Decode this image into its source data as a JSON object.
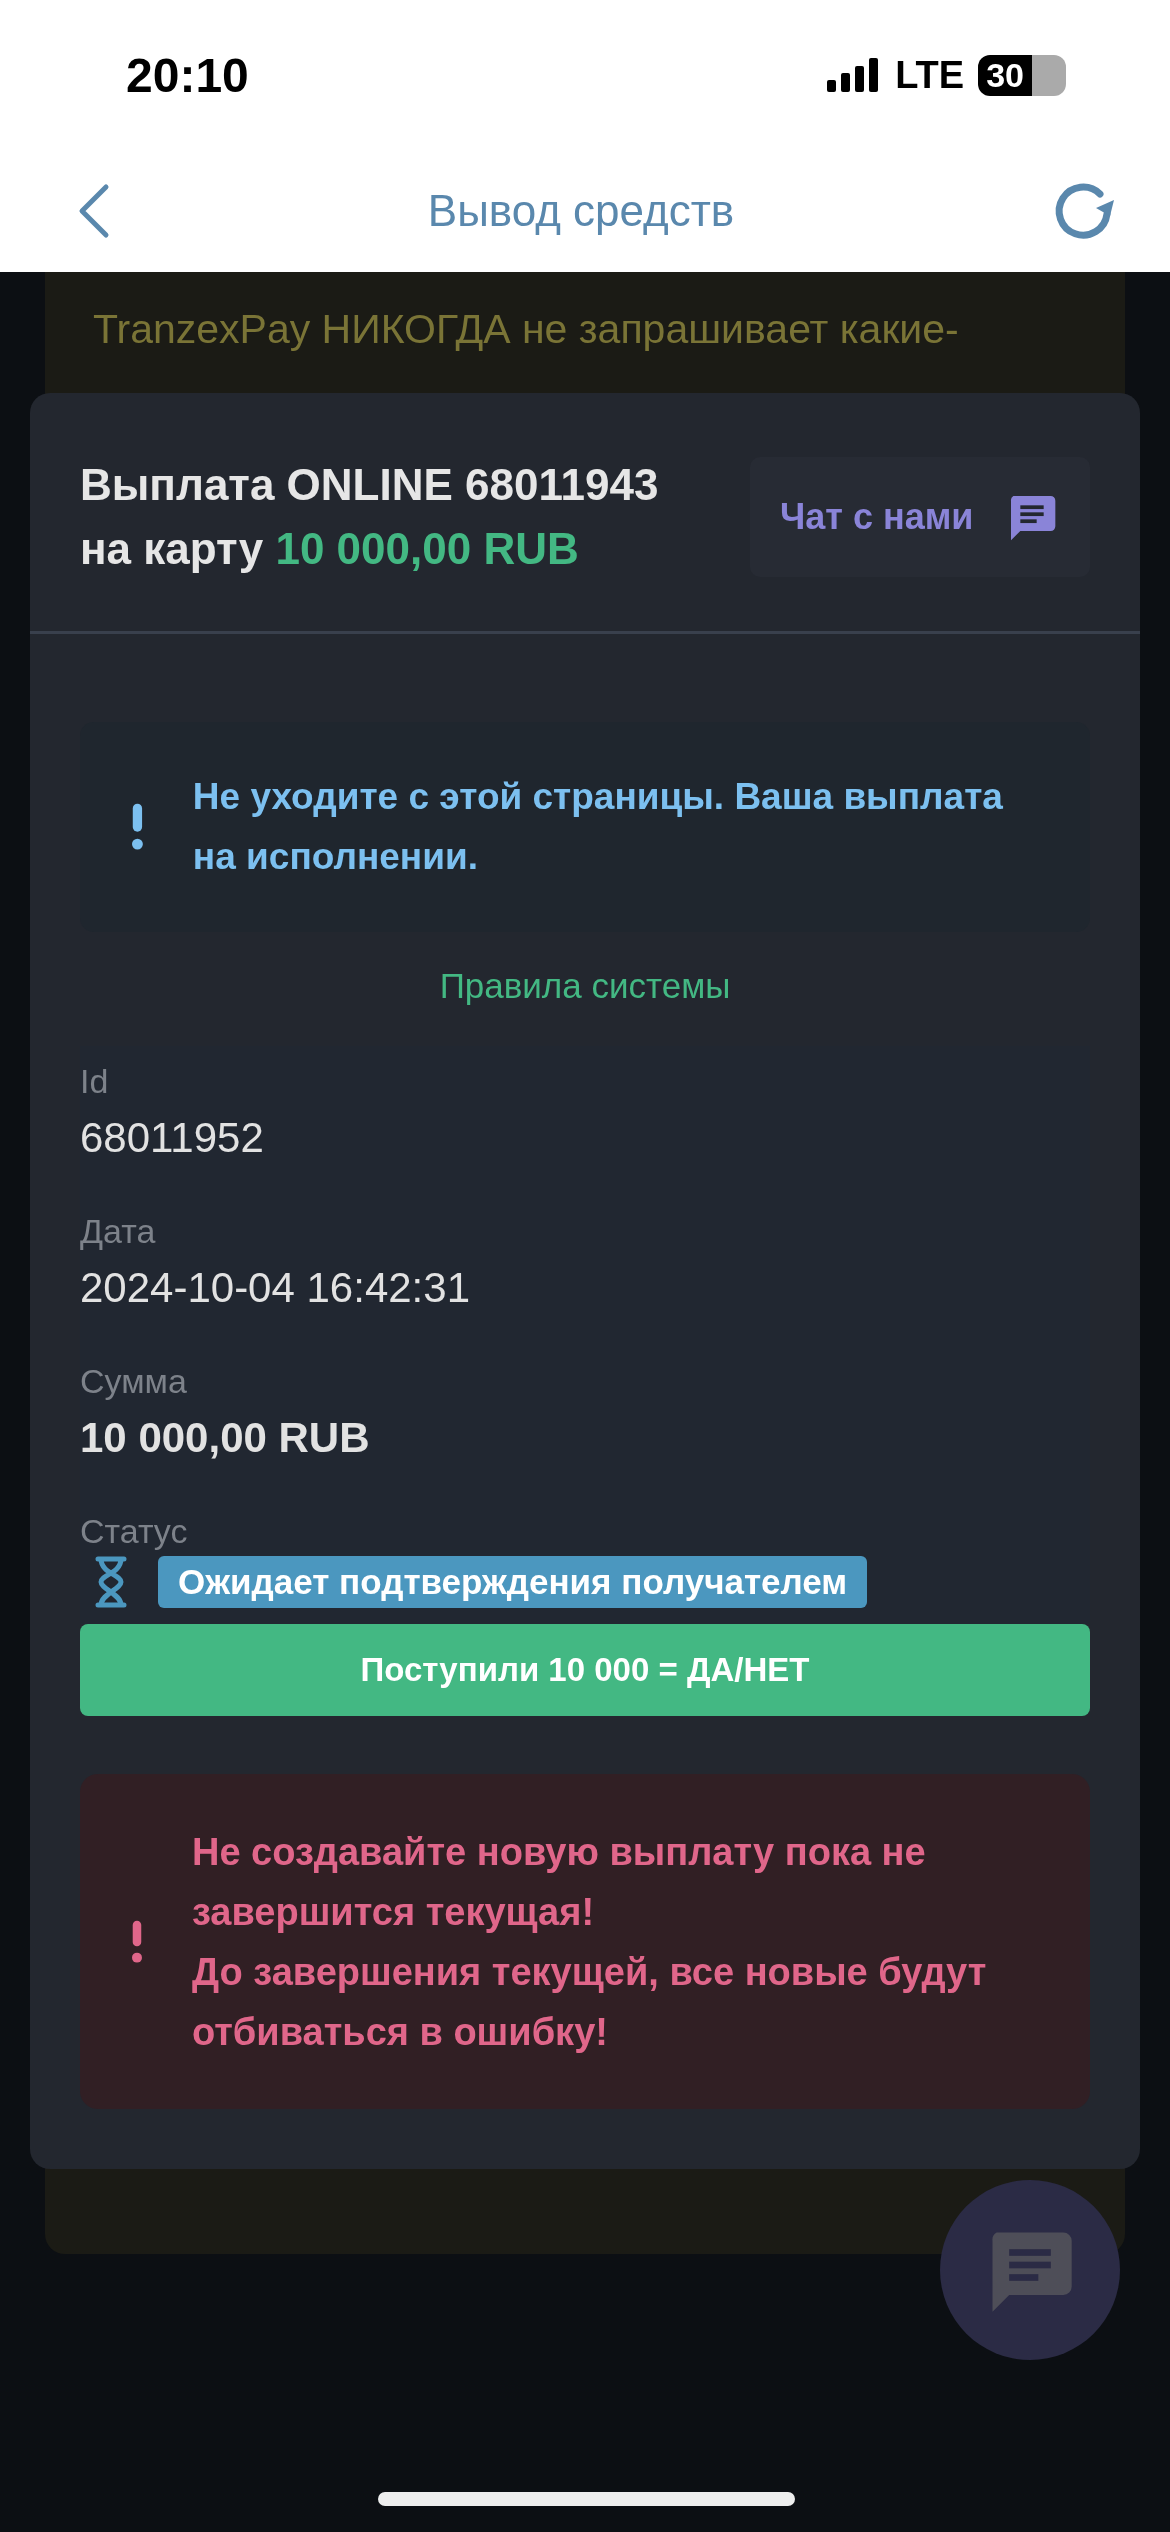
{
  "status_bar": {
    "time": "20:10",
    "network": "LTE",
    "battery": "30"
  },
  "nav": {
    "title": "Вывод средств"
  },
  "background_notice": {
    "lines": [
      "TranzexPay НИКОГДА не запрашивает какие-"
    ]
  },
  "modal": {
    "title": "Выплата ONLINE 68011943 на карту",
    "amount": "10 000,00 RUB",
    "chat_button": "Чат с нами",
    "info_alert": "Не уходите с этой страницы. Ваша выплата на исполнении.",
    "rules_link": "Правила системы",
    "details": [
      {
        "label": "Id",
        "value": "68011952",
        "emphasis": false
      },
      {
        "label": "Дата",
        "value": "2024-10-04 16:42:31",
        "emphasis": false
      },
      {
        "label": "Сумма",
        "value": "10 000,00 RUB",
        "emphasis": true
      }
    ],
    "status": {
      "label": "Статус",
      "badge": "Ожидает подтверждения получателем"
    },
    "confirm_button": "Поступили 10 000 = ДА/НЕТ",
    "warning": [
      "Не создавайте новую выплату пока не завершится текущая!",
      "До завершения текущей, все новые будут отбиваться в ошибку!"
    ]
  }
}
